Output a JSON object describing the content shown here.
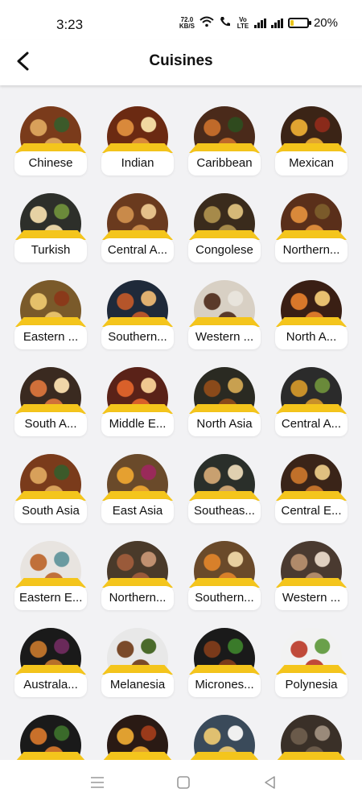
{
  "status": {
    "time": "3:23",
    "net_speed_value": "72.0",
    "net_speed_unit": "KB/S",
    "volte": "Vo LTE",
    "battery": "20%"
  },
  "header": {
    "title": "Cuisines"
  },
  "cuisines": [
    {
      "label": "Chinese",
      "colors": [
        "#7a3b1b",
        "#d8a05a",
        "#3c5a2a"
      ]
    },
    {
      "label": "Indian",
      "colors": [
        "#6b2a12",
        "#d9893b",
        "#f1d8a0"
      ]
    },
    {
      "label": "Caribbean",
      "colors": [
        "#4a2a1a",
        "#c06a2a",
        "#2f4a1e"
      ]
    },
    {
      "label": "Mexican",
      "colors": [
        "#3b2416",
        "#e0a431",
        "#8a2a1a"
      ]
    },
    {
      "label": "Turkish",
      "colors": [
        "#2d2f2a",
        "#e6d2a4",
        "#6b8a3a"
      ]
    },
    {
      "label": "Central A...",
      "colors": [
        "#6a3a1e",
        "#c98a4a",
        "#e5c08a"
      ]
    },
    {
      "label": "Congolese",
      "colors": [
        "#3a2b1c",
        "#a68a4a",
        "#d6b978"
      ]
    },
    {
      "label": "Northern...",
      "colors": [
        "#5a2f1a",
        "#d9893a",
        "#7a5a2a"
      ]
    },
    {
      "label": "Eastern ...",
      "colors": [
        "#7a5a2a",
        "#e5c06a",
        "#8a3a1a"
      ]
    },
    {
      "label": "Southern...",
      "colors": [
        "#1f2a3a",
        "#b5552a",
        "#e0b070"
      ]
    },
    {
      "label": "Western ...",
      "colors": [
        "#d8d0c4",
        "#5a3a2a",
        "#e8e4dc"
      ]
    },
    {
      "label": "North A...",
      "colors": [
        "#3a1f14",
        "#d9782a",
        "#e8c070"
      ]
    },
    {
      "label": "South A...",
      "colors": [
        "#3a2a20",
        "#d0703a",
        "#f0d6a8"
      ]
    },
    {
      "label": "Middle E...",
      "colors": [
        "#5a2218",
        "#d9602a",
        "#f0c890"
      ]
    },
    {
      "label": "North Asia",
      "colors": [
        "#2a2a22",
        "#8a4a1a",
        "#c8a050"
      ]
    },
    {
      "label": "Central A...",
      "colors": [
        "#2b2b2b",
        "#c8902a",
        "#6a8a3a"
      ]
    },
    {
      "label": "South Asia",
      "colors": [
        "#7a3b1b",
        "#d8a05a",
        "#3c5a2a"
      ]
    },
    {
      "label": "East Asia",
      "colors": [
        "#6a4a2a",
        "#e5a030",
        "#9a2a5a"
      ]
    },
    {
      "label": "Southeas...",
      "colors": [
        "#2a2f2a",
        "#c8a070",
        "#e0d0b0"
      ]
    },
    {
      "label": "Central E...",
      "colors": [
        "#3a2418",
        "#c0702a",
        "#e0c080"
      ]
    },
    {
      "label": "Eastern E...",
      "colors": [
        "#e8e4e0",
        "#c0703a",
        "#6a9aa0"
      ]
    },
    {
      "label": "Northern...",
      "colors": [
        "#4a3a2a",
        "#9a5a3a",
        "#c09070"
      ]
    },
    {
      "label": "Southern...",
      "colors": [
        "#6a4a2a",
        "#d8802a",
        "#e8d0a0"
      ]
    },
    {
      "label": "Western ...",
      "colors": [
        "#4a3a30",
        "#b08a6a",
        "#e0d0c0"
      ]
    },
    {
      "label": "Australa...",
      "colors": [
        "#1a1a1a",
        "#b8702a",
        "#6a2a5a"
      ]
    },
    {
      "label": "Melanesia",
      "colors": [
        "#e8e8e8",
        "#7a4a2a",
        "#4a6a2a"
      ]
    },
    {
      "label": "Micrones...",
      "colors": [
        "#1a1a1a",
        "#7a3a1a",
        "#3a7a2a"
      ]
    },
    {
      "label": "Polynesia",
      "colors": [
        "#f2f2f2",
        "#c04a3a",
        "#6aa04a"
      ]
    },
    {
      "label": "",
      "colors": [
        "#1a1a1a",
        "#c8702a",
        "#3a6a2a"
      ]
    },
    {
      "label": "",
      "colors": [
        "#2a1a14",
        "#e0a030",
        "#9a3a1a"
      ]
    },
    {
      "label": "",
      "colors": [
        "#3a4a5a",
        "#e0c070",
        "#f0f0f0"
      ]
    },
    {
      "label": "",
      "colors": [
        "#3a3028",
        "#6a5a4a",
        "#9a8a7a"
      ]
    }
  ],
  "colors": {
    "accent": "#f4c51c"
  }
}
